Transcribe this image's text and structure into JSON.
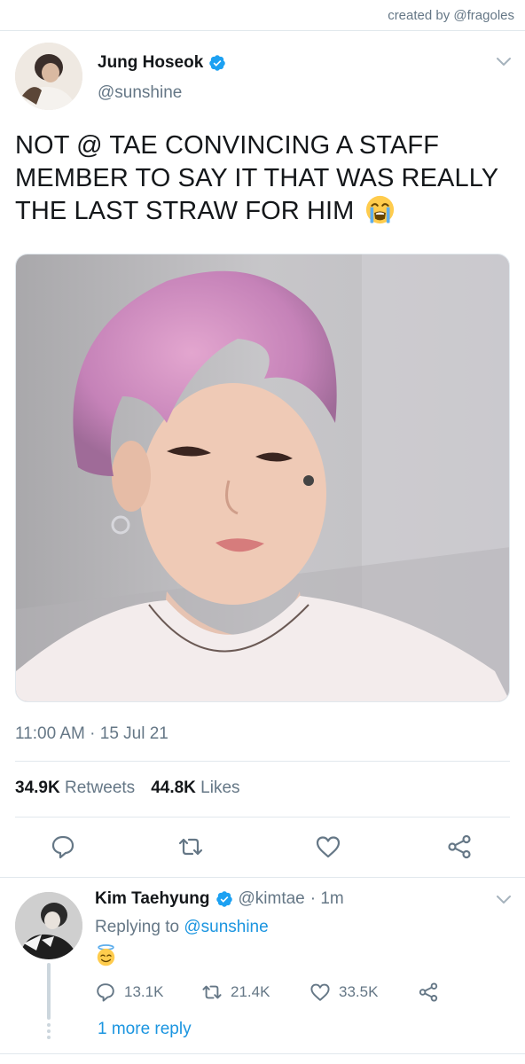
{
  "credit": "created by @fragoles",
  "tweet": {
    "author_name": "Jung Hoseok",
    "author_handle": "@sunshine",
    "text": "NOT @ TAE CONVINCING A STAFF MEMBER TO SAY IT THAT WAS REALLY THE LAST STRAW FOR HIM",
    "emoji": "loudly-crying-face",
    "timestamp": "11:00 AM · 15 Jul 21",
    "retweets_count": "34.9K",
    "retweets_label": "Retweets",
    "likes_count": "44.8K",
    "likes_label": "Likes",
    "icons": [
      "reply-icon",
      "retweet-icon",
      "like-icon",
      "share-icon"
    ]
  },
  "reply": {
    "author_name": "Kim Taehyung",
    "author_handle": "@kimtae",
    "time": "· 1m",
    "replying_prefix": "Replying to",
    "replying_to": "@sunshine",
    "emoji": "smiling-face-with-halo",
    "reply_count": "13.1K",
    "retweet_count": "21.4K",
    "like_count": "33.5K",
    "more_replies": "1 more reply"
  },
  "colors": {
    "link": "#1b95e0",
    "verified": "#1da1f2",
    "secondary_text": "#657786",
    "divider": "#e1e8ed"
  }
}
